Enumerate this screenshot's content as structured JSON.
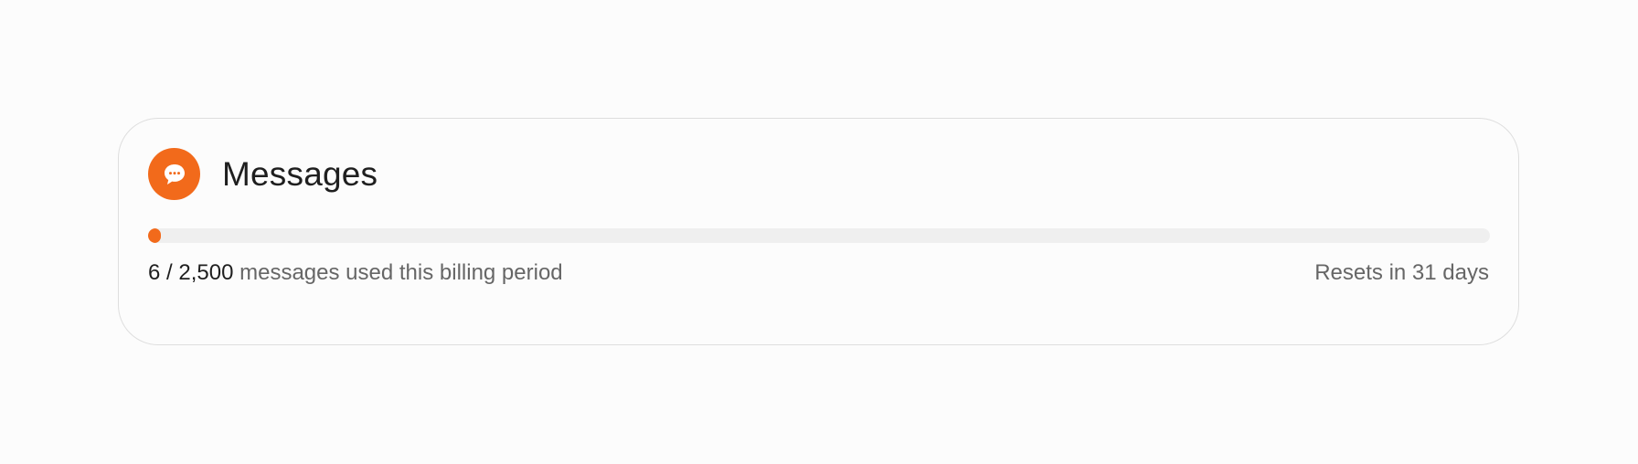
{
  "card": {
    "title": "Messages",
    "icon": "chat-bubble-icon",
    "accent_color": "#f26a1b",
    "usage": {
      "used": "6",
      "separator": "/",
      "limit": "2,500",
      "description": "messages used this billing period",
      "fraction_used": 0.0024
    },
    "reset_text": "Resets in 31 days"
  }
}
